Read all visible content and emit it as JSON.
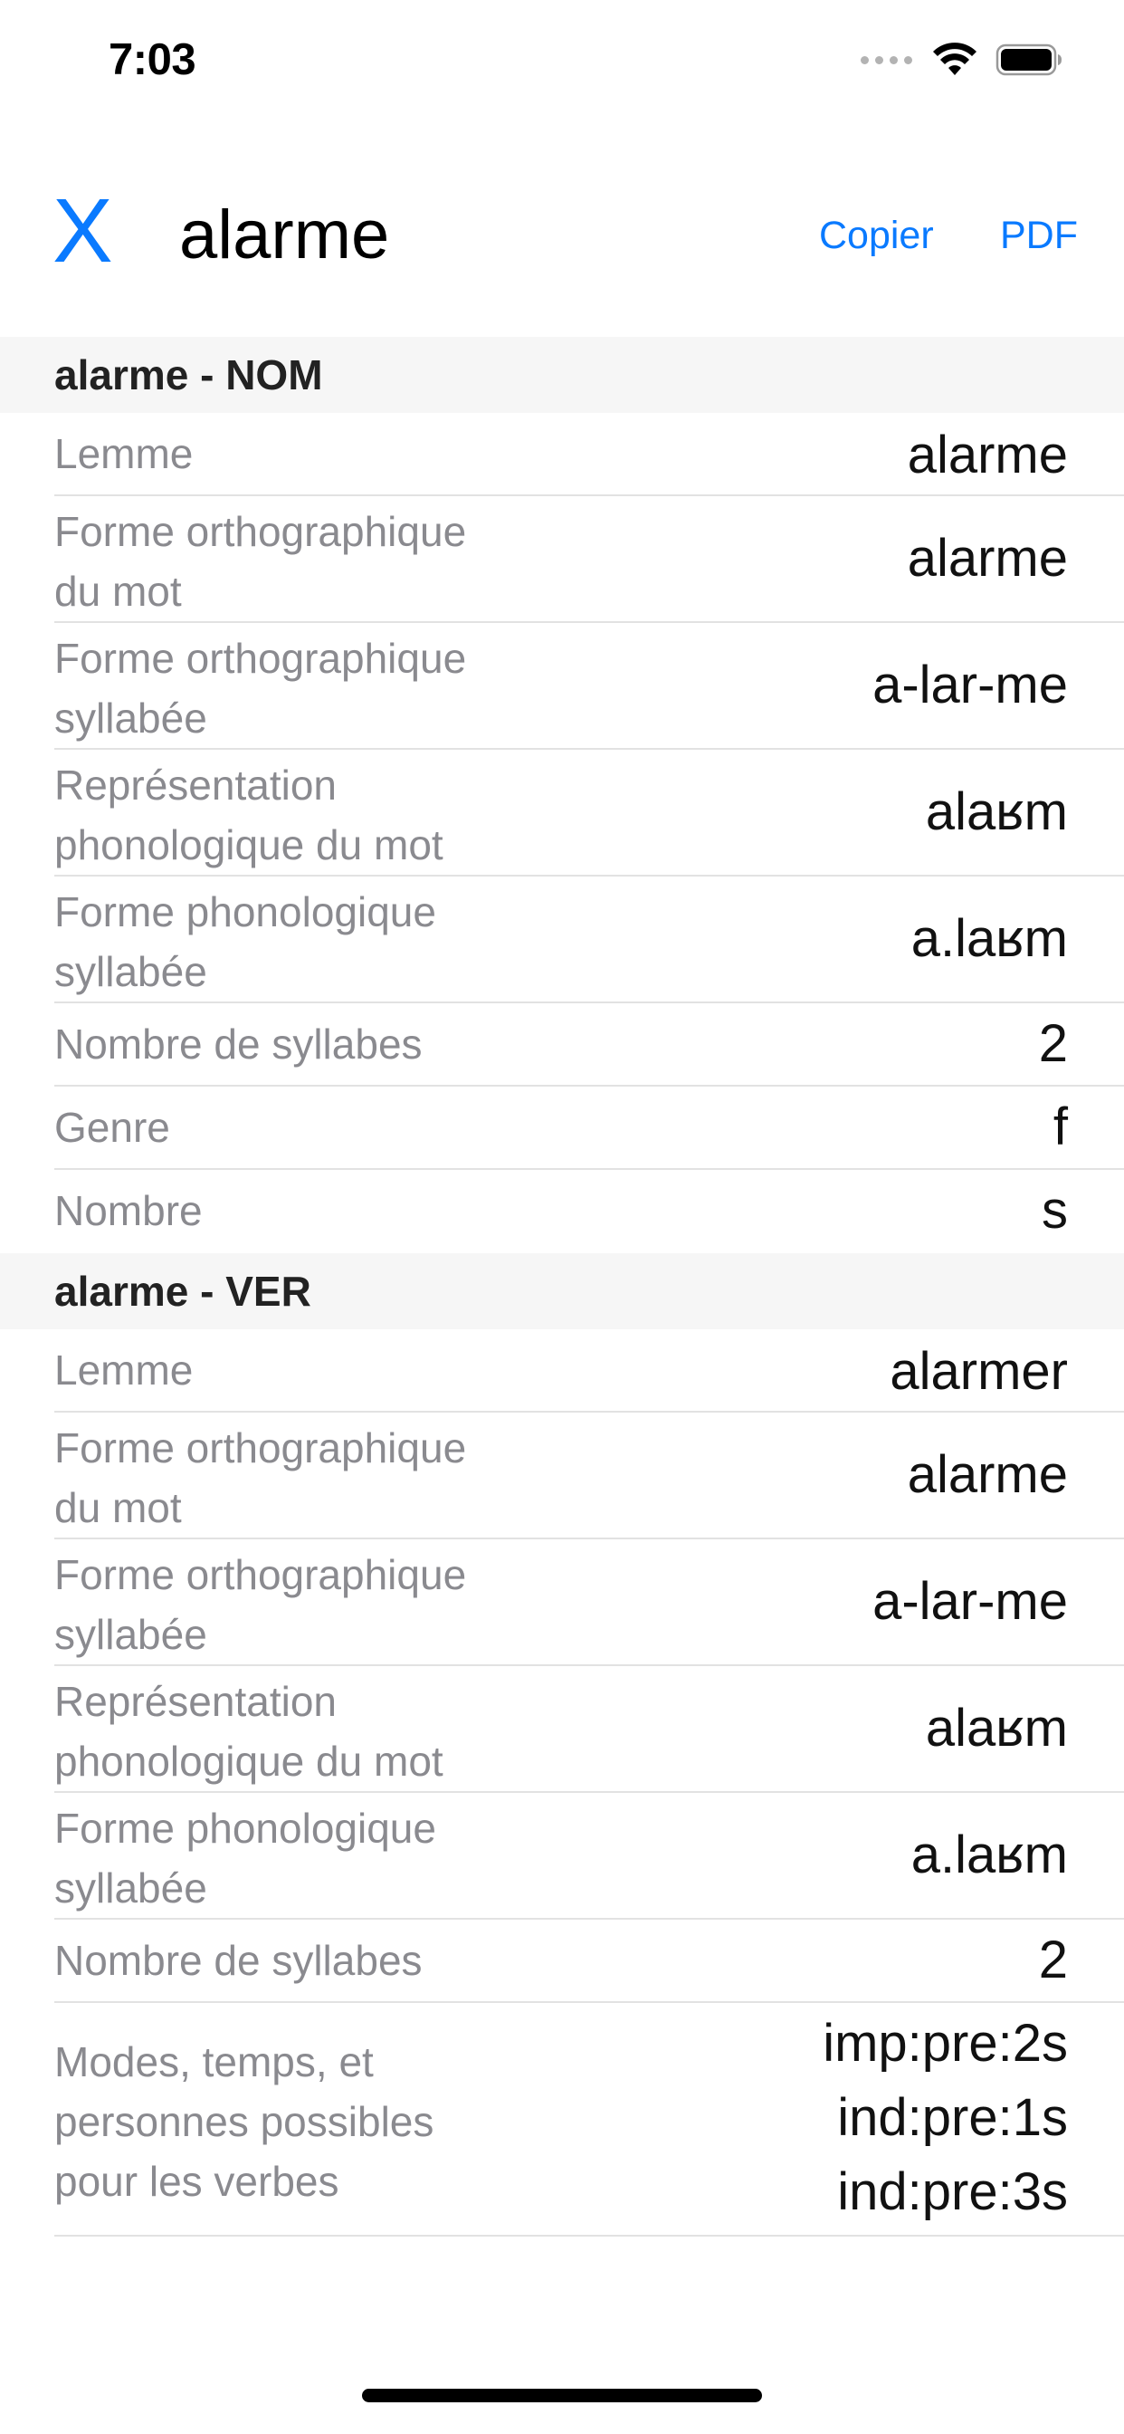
{
  "status_bar": {
    "time": "7:03"
  },
  "header": {
    "close_label": "X",
    "title": "alarme",
    "copy_label": "Copier",
    "pdf_label": "PDF"
  },
  "sections": [
    {
      "title": "alarme - NOM",
      "rows": [
        {
          "label": "Lemme",
          "value": "alarme"
        },
        {
          "label": "Forme orthographique\ndu mot",
          "value": "alarme"
        },
        {
          "label": "Forme orthographique\nsyllabée",
          "value": "a-lar-me"
        },
        {
          "label": "Représentation\nphonologique du mot",
          "value": "alaʁm"
        },
        {
          "label": "Forme phonologique\nsyllabée",
          "value": "a.laʁm"
        },
        {
          "label": "Nombre de syllabes",
          "value": "2"
        },
        {
          "label": "Genre",
          "value": "f"
        },
        {
          "label": "Nombre",
          "value": "s"
        }
      ]
    },
    {
      "title": "alarme - VER",
      "rows": [
        {
          "label": "Lemme",
          "value": "alarmer"
        },
        {
          "label": "Forme orthographique\ndu mot",
          "value": "alarme"
        },
        {
          "label": "Forme orthographique\nsyllabée",
          "value": "a-lar-me"
        },
        {
          "label": "Représentation\nphonologique du mot",
          "value": "alaʁm"
        },
        {
          "label": "Forme phonologique\nsyllabée",
          "value": "a.laʁm"
        },
        {
          "label": "Nombre de syllabes",
          "value": "2"
        },
        {
          "label": "Modes, temps, et\npersonnes possibles\npour les verbes",
          "value": "imp:pre:2s\nind:pre:1s\nind:pre:3s"
        }
      ]
    }
  ]
}
